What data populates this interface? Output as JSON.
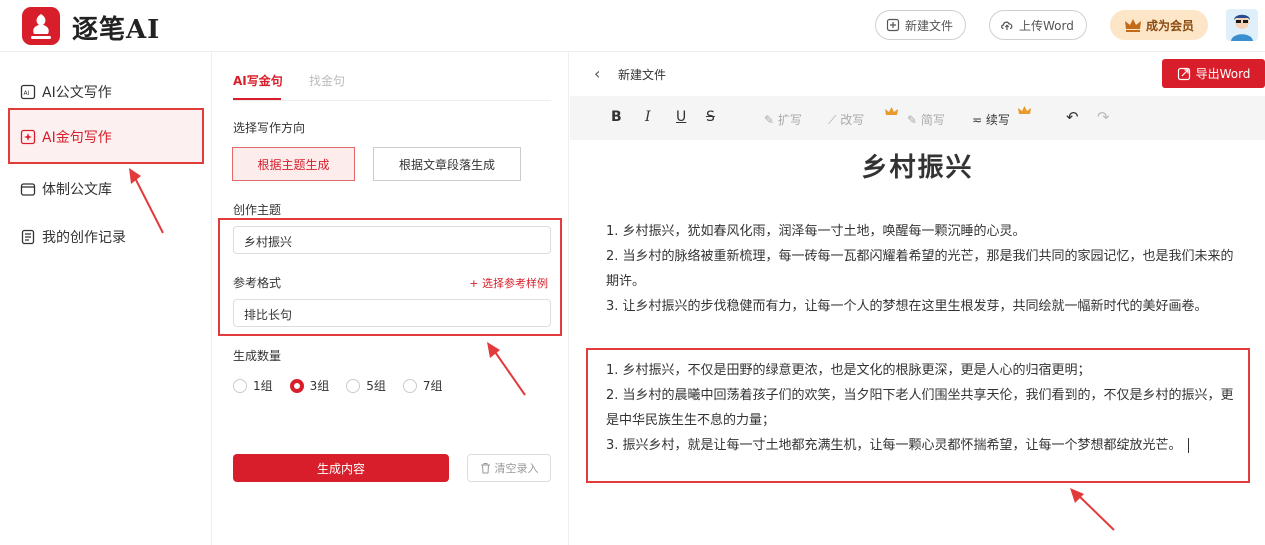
{
  "header": {
    "brand": "逐笔AI",
    "new_file": "新建文件",
    "upload_word": "上传Word",
    "vip": "成为会员"
  },
  "sidebar": {
    "items": [
      {
        "label": "AI公文写作",
        "icon": "document-ai-icon"
      },
      {
        "label": "AI金句写作",
        "icon": "sparkle-doc-icon"
      },
      {
        "label": "体制公文库",
        "icon": "folder-icon"
      },
      {
        "label": "我的创作记录",
        "icon": "record-icon"
      }
    ]
  },
  "panel": {
    "tabs": [
      "AI写金句",
      "找金句"
    ],
    "direction_label": "选择写作方向",
    "direction_options": [
      "根据主题生成",
      "根据文章段落生成"
    ],
    "topic_label": "创作主题",
    "topic_value": "乡村振兴",
    "format_label": "参考格式",
    "pick_sample": "+ 选择参考样例",
    "format_value": "排比长句",
    "count_label": "生成数量",
    "counts": [
      "1组",
      "3组",
      "5组",
      "7组"
    ],
    "generate": "生成内容",
    "clear": "清空录入"
  },
  "editor": {
    "doc_name": "新建文件",
    "export": "导出Word",
    "toolbar": {
      "bold": "B",
      "italic": "I",
      "underline": "U",
      "strike": "S",
      "expand": "扩写",
      "rewrite": "改写",
      "shorten": "简写",
      "continue": "续写"
    },
    "title": "乡村振兴",
    "group1": [
      "1. 乡村振兴，犹如春风化雨，润泽每一寸土地，唤醒每一颗沉睡的心灵。",
      "2. 当乡村的脉络被重新梳理，每一砖每一瓦都闪耀着希望的光芒，那是我们共同的家园记忆，也是我们未来的期许。",
      "3. 让乡村振兴的步伐稳健而有力，让每一个人的梦想在这里生根发芽，共同绘就一幅新时代的美好画卷。"
    ],
    "group2": [
      "1. 乡村振兴，不仅是田野的绿意更浓，也是文化的根脉更深，更是人心的归宿更明；",
      "2. 当乡村的晨曦中回荡着孩子们的欢笑，当夕阳下老人们围坐共享天伦，我们看到的，不仅是乡村的振兴，更是中华民族生生不息的力量；",
      "3. 振兴乡村，就是让每一寸土地都充满生机，让每一颗心灵都怀揣希望，让每一个梦想都绽放光芒。"
    ]
  },
  "colors": {
    "accent": "#d81e2a",
    "highlight": "#e23b3b"
  }
}
